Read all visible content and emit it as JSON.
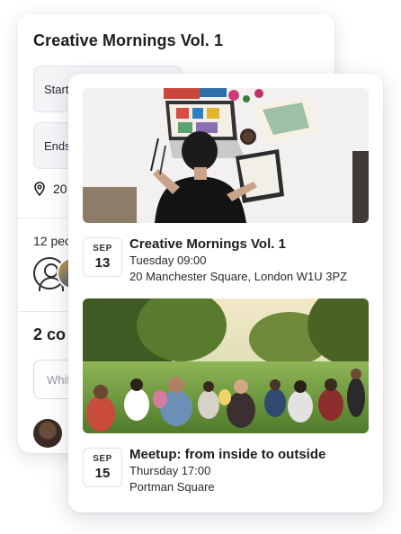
{
  "background_event": {
    "title": "Creative Mornings Vol. 1",
    "starts_label": "Starts",
    "ends_label": "Ends",
    "location_short": "20",
    "attendees_text": "12 peo",
    "comments_heading": "2 co",
    "comment_placeholder": "Whit"
  },
  "events": [
    {
      "month": "SEP",
      "day": "13",
      "title": "Creative Mornings Vol. 1",
      "time": "Tuesday 09:00",
      "location": "20 Manchester Square, London W1U 3PZ"
    },
    {
      "month": "SEP",
      "day": "15",
      "title": "Meetup: from inside to outside",
      "time": "Thursday 17:00",
      "location": "Portman Square"
    }
  ],
  "colors": {
    "text": "#1d1d22",
    "field_bg": "#f7f4f8",
    "border": "#e3dfe6"
  }
}
